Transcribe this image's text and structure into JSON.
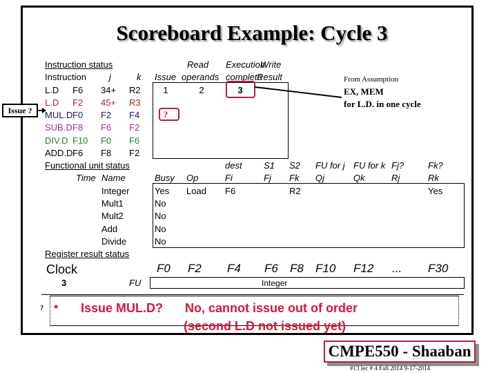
{
  "title": "Scoreboard Example:  Cycle 3",
  "issue_callout": "Issue ?",
  "instruction_status": {
    "heading": "Instruction status",
    "headers": {
      "instruction": "Instruction",
      "j": "j",
      "k": "k",
      "issue": "Issue",
      "read_1": "Read",
      "read_2": "operands",
      "exec_1": "Execution",
      "exec_2": "complete",
      "write_1": "Write",
      "write_2": "Result"
    },
    "rows": [
      {
        "op": "L.D",
        "dest": "F6",
        "j": "34+",
        "k": "R2",
        "issue": "1",
        "read": "2",
        "exec": "3",
        "write": "",
        "color": "#000000"
      },
      {
        "op": "L.D",
        "dest": "F2",
        "j": "45+",
        "k": "R3",
        "issue": "?",
        "read": "",
        "exec": "",
        "write": "",
        "color": "#a0282c"
      },
      {
        "op": "MUL.D",
        "dest": "F0",
        "j": "F2",
        "k": "F4",
        "issue": "",
        "read": "",
        "exec": "",
        "write": "",
        "color": "#1a1a6e"
      },
      {
        "op": "SUB.D",
        "dest": "F8",
        "j": "F6",
        "k": "F2",
        "issue": "",
        "read": "",
        "exec": "",
        "write": "",
        "color": "#a0309a"
      },
      {
        "op": "DIV.D",
        "dest": "F10",
        "j": "F0",
        "k": "F6",
        "issue": "",
        "read": "",
        "exec": "",
        "write": "",
        "color": "#2e7a2e"
      },
      {
        "op": "ADD.D",
        "dest": "F6",
        "j": "F8",
        "k": "F2",
        "issue": "",
        "read": "",
        "exec": "",
        "write": "",
        "color": "#000000"
      }
    ]
  },
  "annotation": {
    "line1": "From Assumption",
    "line2": "EX, MEM",
    "line3": "for L.D. in one cycle"
  },
  "functional_unit_status": {
    "heading": "Functional unit status",
    "headers_top": {
      "dest": "dest",
      "s1": "S1",
      "s2": "S2",
      "qj": "FU for j",
      "qk": "FU for k",
      "rj": "Fj?",
      "rk": "Fk?"
    },
    "headers": {
      "time": "Time",
      "name": "Name",
      "busy": "Busy",
      "op": "Op",
      "fi": "Fi",
      "fj": "Fj",
      "fk": "Fk",
      "qj": "Qj",
      "qk": "Qk",
      "rj": "Rj",
      "rk": "Rk"
    },
    "rows": [
      {
        "name": "Integer",
        "busy": "Yes",
        "op": "Load",
        "fi": "F6",
        "fj": "",
        "fk": "R2",
        "qj": "",
        "qk": "",
        "rj": "",
        "rk": "Yes"
      },
      {
        "name": "Mult1",
        "busy": "No"
      },
      {
        "name": "Mult2",
        "busy": "No"
      },
      {
        "name": "Add",
        "busy": "No"
      },
      {
        "name": "Divide",
        "busy": "No"
      }
    ]
  },
  "register_result_status": {
    "heading": "Register result status",
    "clock_label": "Clock",
    "clock_value": "3",
    "fu_label": "FU",
    "registers": [
      "F0",
      "F2",
      "F4",
      "F6",
      "F8",
      "F10",
      "F12",
      "...",
      "F30"
    ],
    "values": [
      "",
      "",
      "",
      "Integer",
      "",
      "",
      "",
      "",
      ""
    ]
  },
  "bullet": {
    "marker": "?",
    "question": "Issue MUL.D?",
    "answer_line1": "No, cannot issue out of order",
    "answer_line2": "(second L.D not issued yet)"
  },
  "footer": {
    "badge": "CMPE550 - Shaaban",
    "meta": "#13  lec # 4 Fall 2014   9-17-2014"
  },
  "colors": {
    "accent_red": "#d3183a",
    "highlight_border": "#b0223c"
  }
}
